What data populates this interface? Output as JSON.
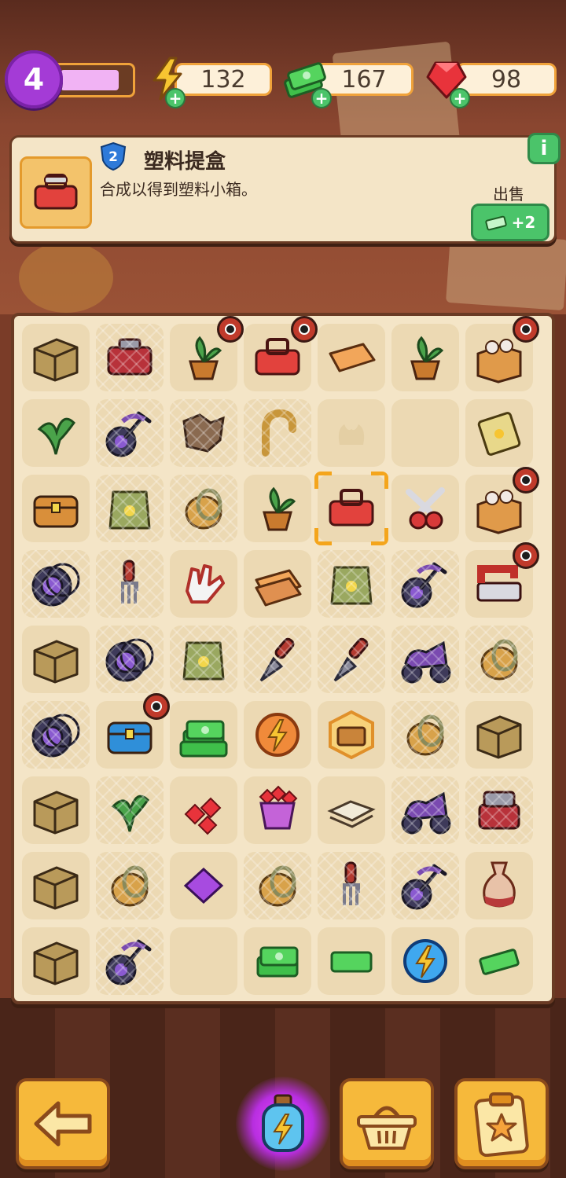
{
  "player": {
    "level": "4",
    "xp_fraction": 0.88
  },
  "resources": [
    {
      "id": "energy",
      "value": "132",
      "icon": "lightning-icon"
    },
    {
      "id": "cash",
      "value": "167",
      "icon": "cash-stack-icon"
    },
    {
      "id": "gems",
      "value": "98",
      "icon": "red-gem-icon"
    }
  ],
  "info": {
    "item_level": "2",
    "item_name": "塑料提盒",
    "description": "合成以得到塑料小箱。",
    "sell_label": "出售",
    "sell_value": "+2",
    "info_glyph": "i",
    "plus_glyph": "+"
  },
  "board": {
    "rows": 9,
    "cols": 7,
    "cells": [
      [
        "cardboard-box",
        "red-toolbox",
        "potted-seedling-bag",
        "red-plastic-box",
        "orange-mat",
        "potted-plant",
        "open-box-dishes"
      ],
      [
        "green-leaf-sprout",
        "purple-wheel-scooter",
        "burnt-paper",
        "brass-hook",
        "empty-leaf-silhouette",
        "empty",
        "seed-packet"
      ],
      [
        "wooden-chest",
        "seed-bag",
        "brass-ring",
        "small-potted-sprout",
        "red-plastic-toolbox",
        "pruning-shears",
        "open-box-dishes"
      ],
      [
        "purple-tires",
        "garden-fork",
        "white-gloves",
        "stacked-mats",
        "green-backpack",
        "purple-wheel-scooter",
        "sewing-machine"
      ],
      [
        "cardboard-box-open",
        "purple-tires",
        "green-backpack",
        "trowel",
        "trowel",
        "purple-moped",
        "brass-ring"
      ],
      [
        "purple-tires",
        "blue-chest",
        "cash-pile",
        "energy-orb",
        "glowing-crate",
        "brass-ring",
        "cardboard-box-large"
      ],
      [
        "cardboard-box",
        "green-leaf-sprout",
        "red-gems",
        "gem-basket",
        "paper-stack",
        "purple-moped",
        "red-toolbox-open"
      ],
      [
        "cardboard-box-open",
        "brass-ring",
        "purple-gem",
        "brass-ring",
        "garden-fork",
        "purple-wheel-scooter",
        "ceramic-vase"
      ],
      [
        "cardboard-box",
        "purple-wheel-scooter",
        "empty",
        "cash-stack",
        "cash-small",
        "blue-energy-orb",
        "cash-note"
      ]
    ],
    "locked_cells": [
      "0-2",
      "0-3",
      "0-6",
      "2-6",
      "3-6",
      "5-1"
    ],
    "webbed_cells": [
      "0-1",
      "1-1",
      "1-2",
      "1-3",
      "2-1",
      "2-2",
      "3-0",
      "3-1",
      "3-4",
      "3-5",
      "4-1",
      "4-2",
      "4-3",
      "4-4",
      "4-5",
      "4-6",
      "5-0",
      "5-5",
      "6-1",
      "6-5",
      "6-6",
      "7-1",
      "7-3",
      "7-4",
      "7-5",
      "8-1"
    ],
    "selected_cell": "2-4"
  },
  "nav": [
    {
      "id": "back",
      "icon": "back-arrow-icon"
    },
    {
      "id": "boost",
      "icon": "energy-bottle-icon"
    },
    {
      "id": "shop",
      "icon": "basket-icon"
    },
    {
      "id": "tasks",
      "icon": "clipboard-star-icon"
    }
  ],
  "colors": {
    "accent_orange": "#f4a51c",
    "sell_green": "#4bc46a",
    "level_purple": "#a43bd6",
    "panel_cream": "#f4e5c7",
    "frame_brown": "#6a3b24"
  }
}
